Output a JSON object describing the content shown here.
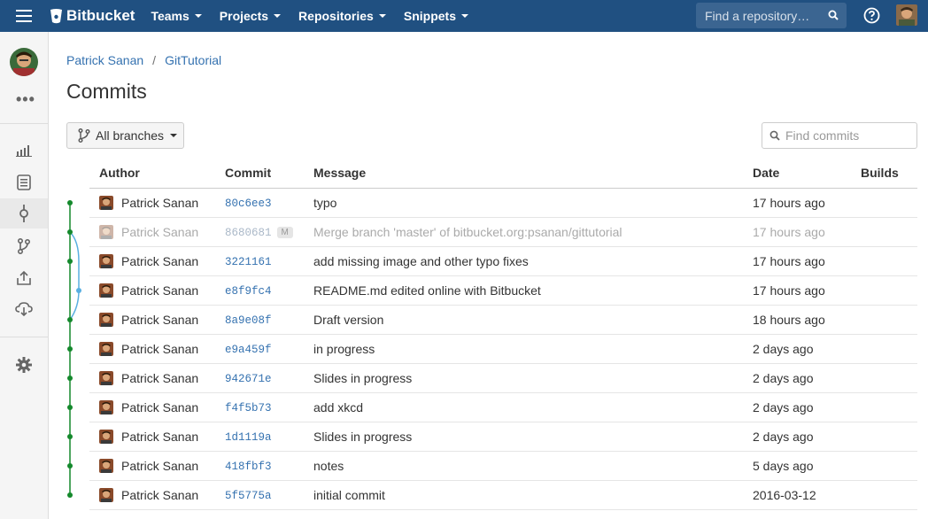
{
  "brand": {
    "name": "Bitbucket"
  },
  "topnav": {
    "items": [
      {
        "label": "Teams"
      },
      {
        "label": "Projects"
      },
      {
        "label": "Repositories"
      },
      {
        "label": "Snippets"
      }
    ],
    "search_placeholder": "Find a repository…"
  },
  "sidebar": {
    "icons": [
      "overview-icon",
      "source-icon",
      "commits-icon",
      "branches-icon",
      "pull-requests-icon",
      "downloads-icon",
      "settings-icon"
    ]
  },
  "breadcrumb": {
    "owner": "Patrick Sanan",
    "repo": "GitTutorial"
  },
  "page": {
    "title": "Commits"
  },
  "filters": {
    "branch_label": "All branches",
    "search_placeholder": "Find commits"
  },
  "table": {
    "headers": {
      "author": "Author",
      "commit": "Commit",
      "message": "Message",
      "date": "Date",
      "builds": "Builds"
    },
    "rows": [
      {
        "author": "Patrick Sanan",
        "hash": "80c6ee3",
        "message": "typo",
        "date": "17 hours ago"
      },
      {
        "author": "Patrick Sanan",
        "hash": "8680681",
        "badge": "M",
        "message": "Merge branch 'master' of bitbucket.org:psanan/gittutorial",
        "date": "17 hours ago"
      },
      {
        "author": "Patrick Sanan",
        "hash": "3221161",
        "message": "add missing image and other typo fixes",
        "date": "17 hours ago"
      },
      {
        "author": "Patrick Sanan",
        "hash": "e8f9fc4",
        "message": "README.md edited online with Bitbucket",
        "date": "17 hours ago"
      },
      {
        "author": "Patrick Sanan",
        "hash": "8a9e08f",
        "message": "Draft version",
        "date": "18 hours ago"
      },
      {
        "author": "Patrick Sanan",
        "hash": "e9a459f",
        "message": "in progress",
        "date": "2 days ago"
      },
      {
        "author": "Patrick Sanan",
        "hash": "942671e",
        "message": "Slides in progress",
        "date": "2 days ago"
      },
      {
        "author": "Patrick Sanan",
        "hash": "f4f5b73",
        "message": "add xkcd",
        "date": "2 days ago"
      },
      {
        "author": "Patrick Sanan",
        "hash": "1d1119a",
        "message": "Slides in progress",
        "date": "2 days ago"
      },
      {
        "author": "Patrick Sanan",
        "hash": "418fbf3",
        "message": "notes",
        "date": "5 days ago"
      },
      {
        "author": "Patrick Sanan",
        "hash": "5f5775a",
        "message": "initial commit",
        "date": "2016-03-12"
      }
    ]
  },
  "colors": {
    "header_bg": "#205081",
    "link": "#3572b0",
    "graph_main": "#14892c",
    "graph_branch": "#59afe1"
  }
}
